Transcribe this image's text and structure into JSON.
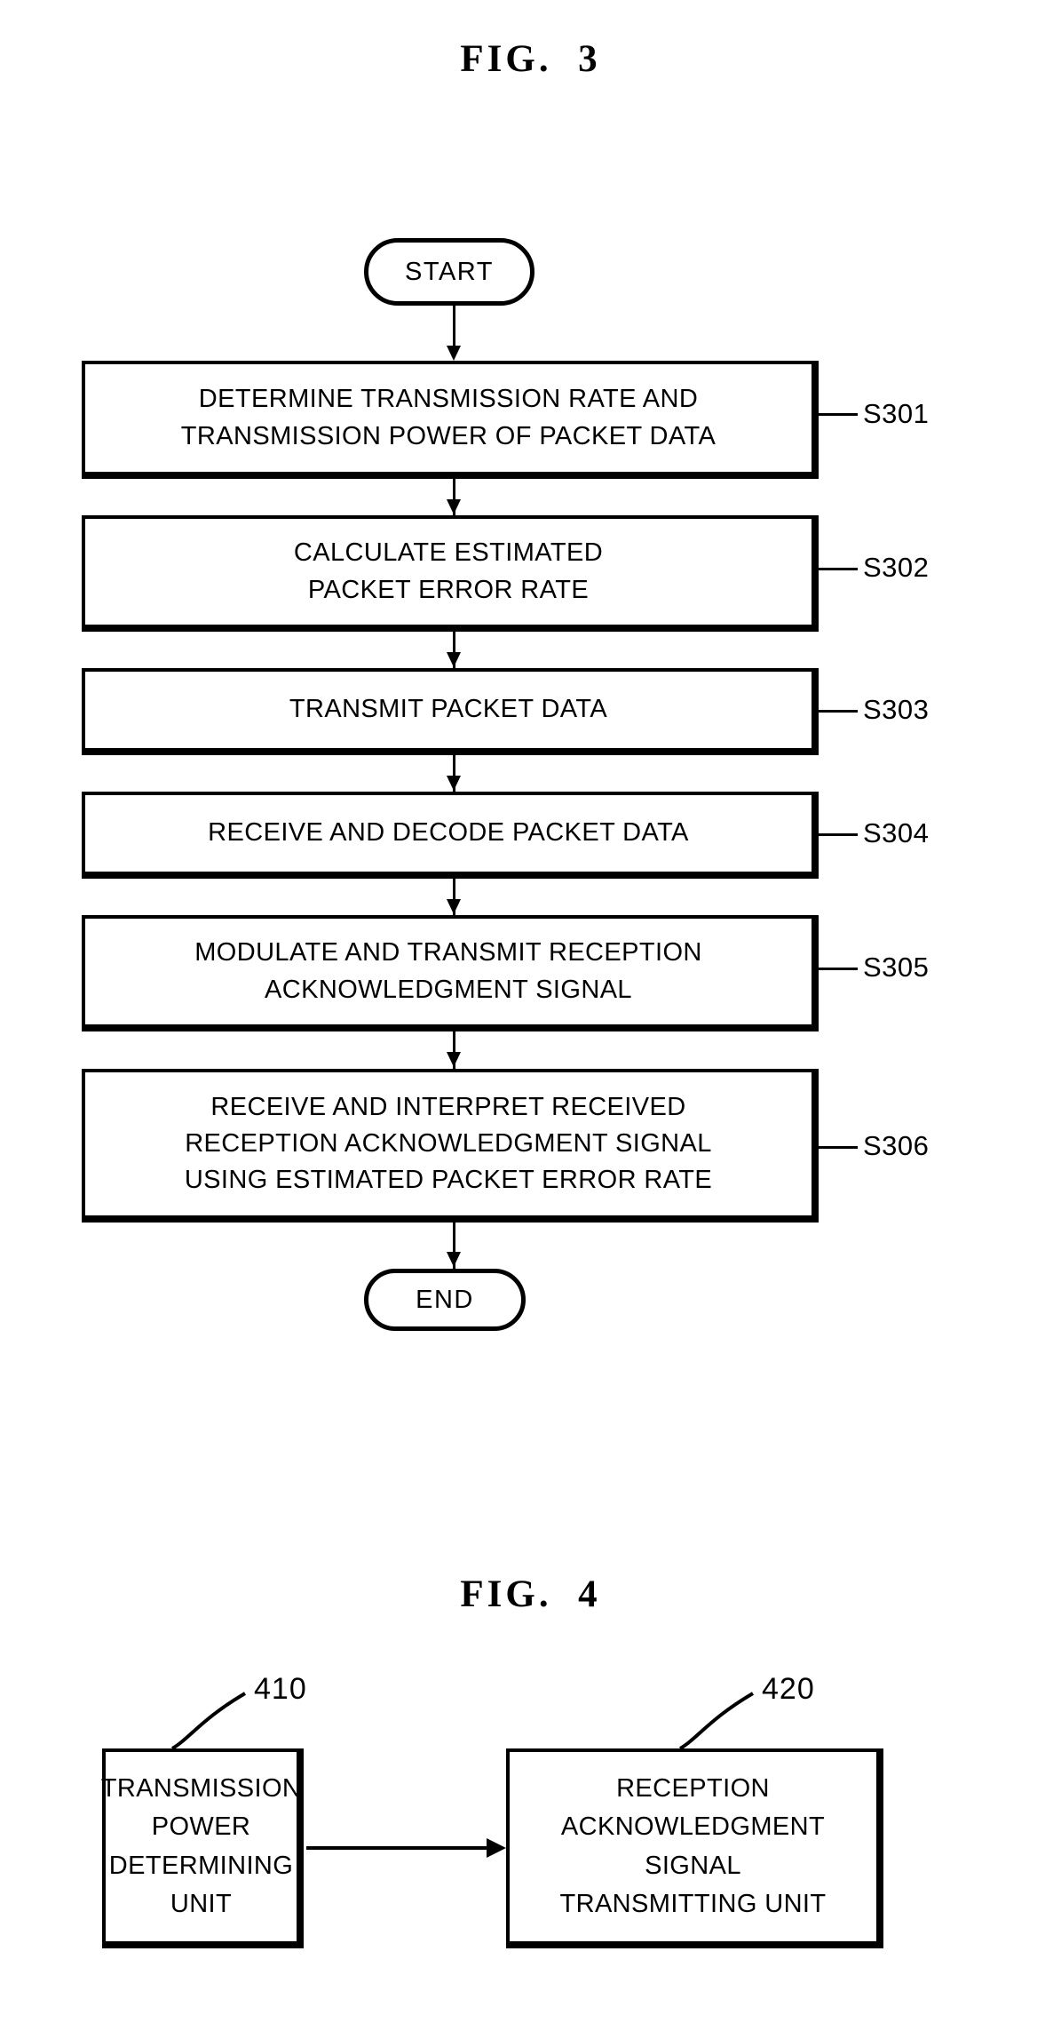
{
  "figures": [
    {
      "title": "FIG.  3",
      "start_label": "START",
      "end_label": "END",
      "steps": [
        {
          "ref": "S301",
          "text": "DETERMINE TRANSMISSION RATE AND\nTRANSMISSION POWER OF PACKET DATA"
        },
        {
          "ref": "S302",
          "text": "CALCULATE ESTIMATED\nPACKET ERROR RATE"
        },
        {
          "ref": "S303",
          "text": "TRANSMIT PACKET DATA"
        },
        {
          "ref": "S304",
          "text": "RECEIVE AND DECODE PACKET DATA"
        },
        {
          "ref": "S305",
          "text": "MODULATE AND TRANSMIT RECEPTION\nACKNOWLEDGMENT SIGNAL"
        },
        {
          "ref": "S306",
          "text": "RECEIVE AND INTERPRET RECEIVED\nRECEPTION ACKNOWLEDGMENT SIGNAL\nUSING ESTIMATED PACKET ERROR RATE"
        }
      ]
    },
    {
      "title": "FIG.  4",
      "units": [
        {
          "ref": "410",
          "text": "TRANSMISSION\nPOWER\nDETERMINING\nUNIT"
        },
        {
          "ref": "420",
          "text": "RECEPTION\nACKNOWLEDGMENT\nSIGNAL\nTRANSMITTING UNIT"
        }
      ]
    }
  ],
  "colors": {
    "ink": "#000000",
    "paper": "#ffffff"
  }
}
